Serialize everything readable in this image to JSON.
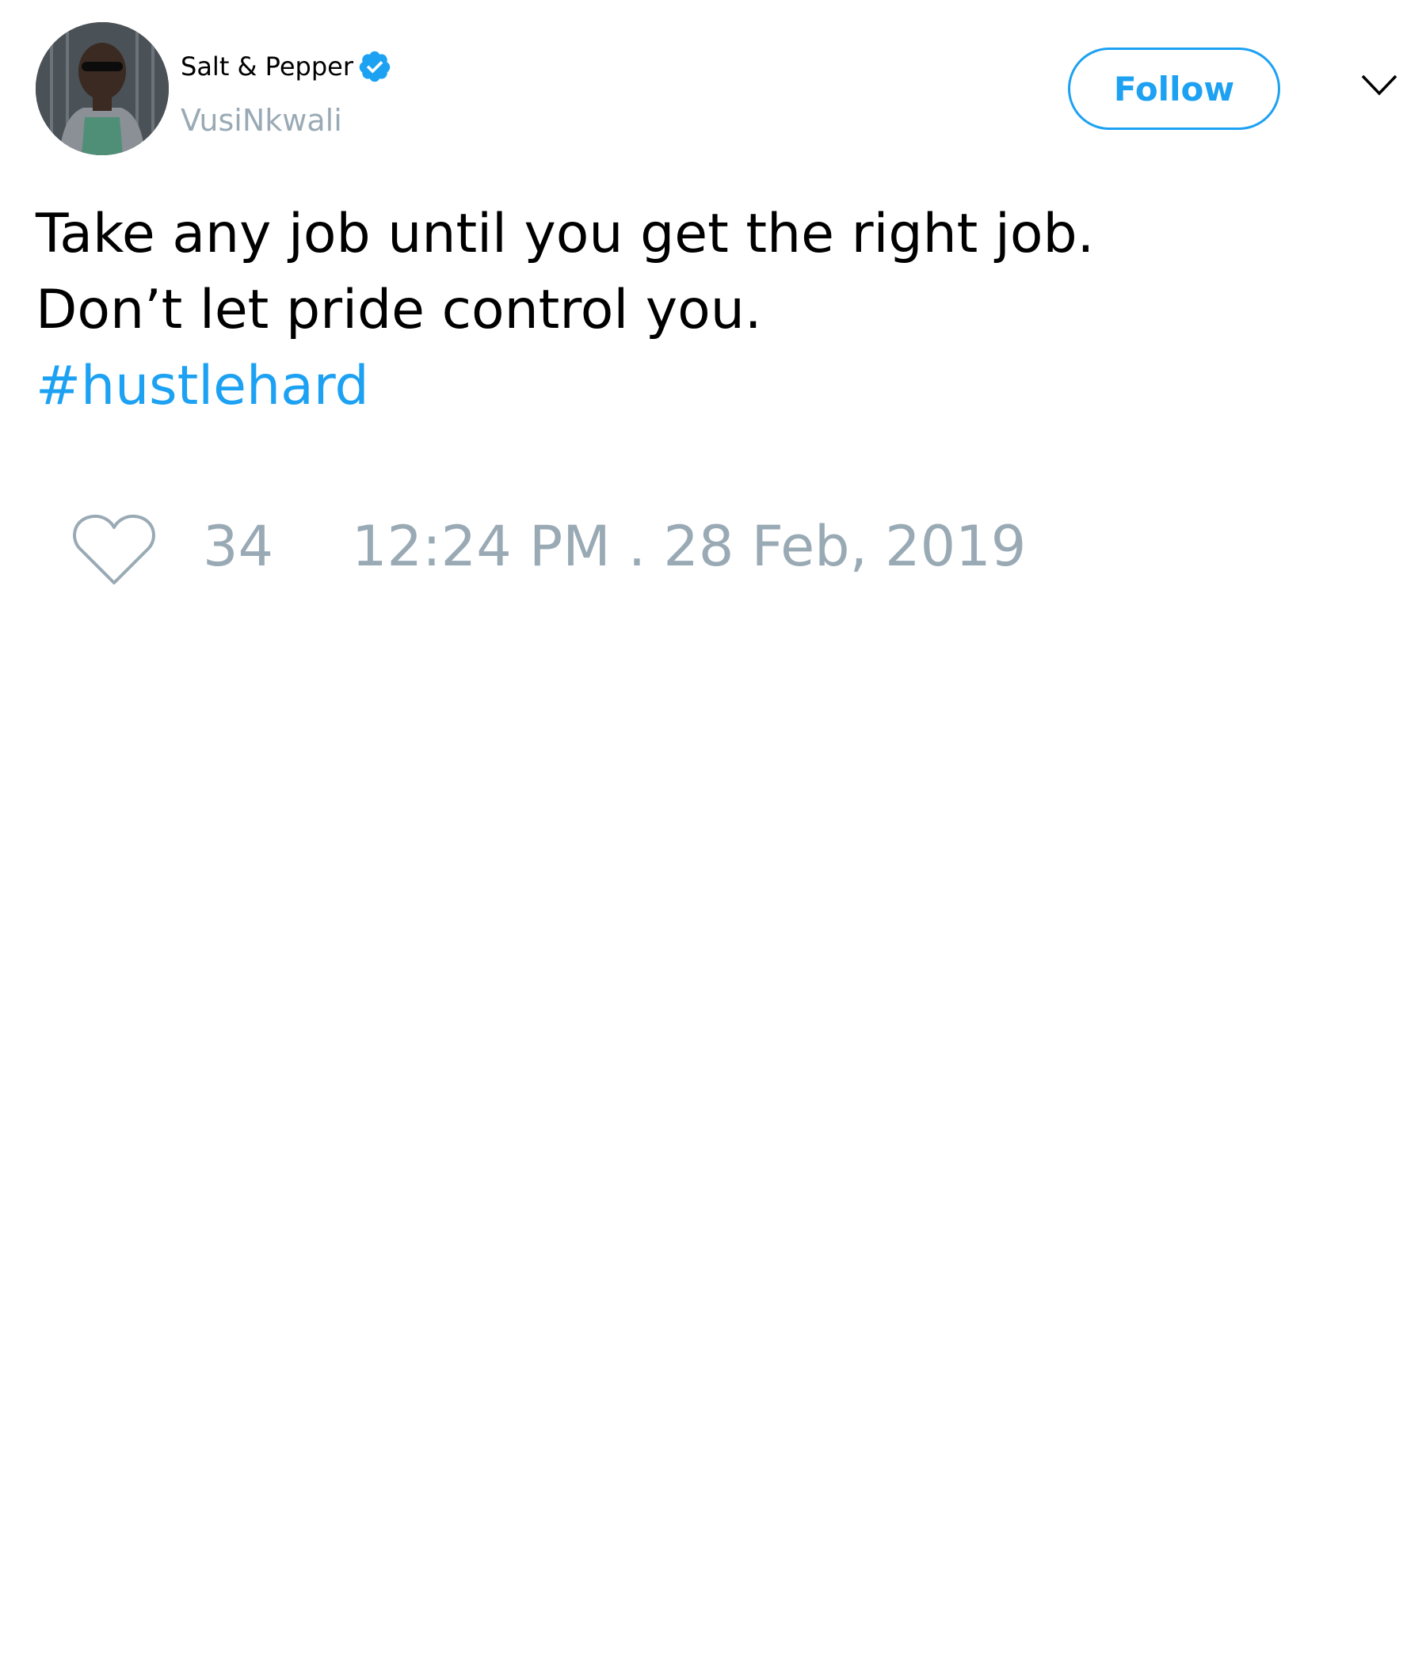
{
  "author": {
    "display_name": "Salt & Pepper",
    "handle": "VusiNkwali",
    "verified": true,
    "avatar_icon": "profile-photo"
  },
  "actions": {
    "follow_label": "Follow",
    "menu_icon": "chevron-down-icon"
  },
  "tweet": {
    "lines": [
      "Take any job until you get the right job.",
      "Don’t let pride control you."
    ],
    "hashtag": "#hustlehard"
  },
  "engagement": {
    "like_icon": "heart-icon",
    "like_count": "34",
    "timestamp": "12:24 PM . 28 Feb, 2019"
  },
  "colors": {
    "accent": "#1da1f2",
    "muted": "#99aab5",
    "text": "#000000",
    "background": "#ffffff"
  }
}
